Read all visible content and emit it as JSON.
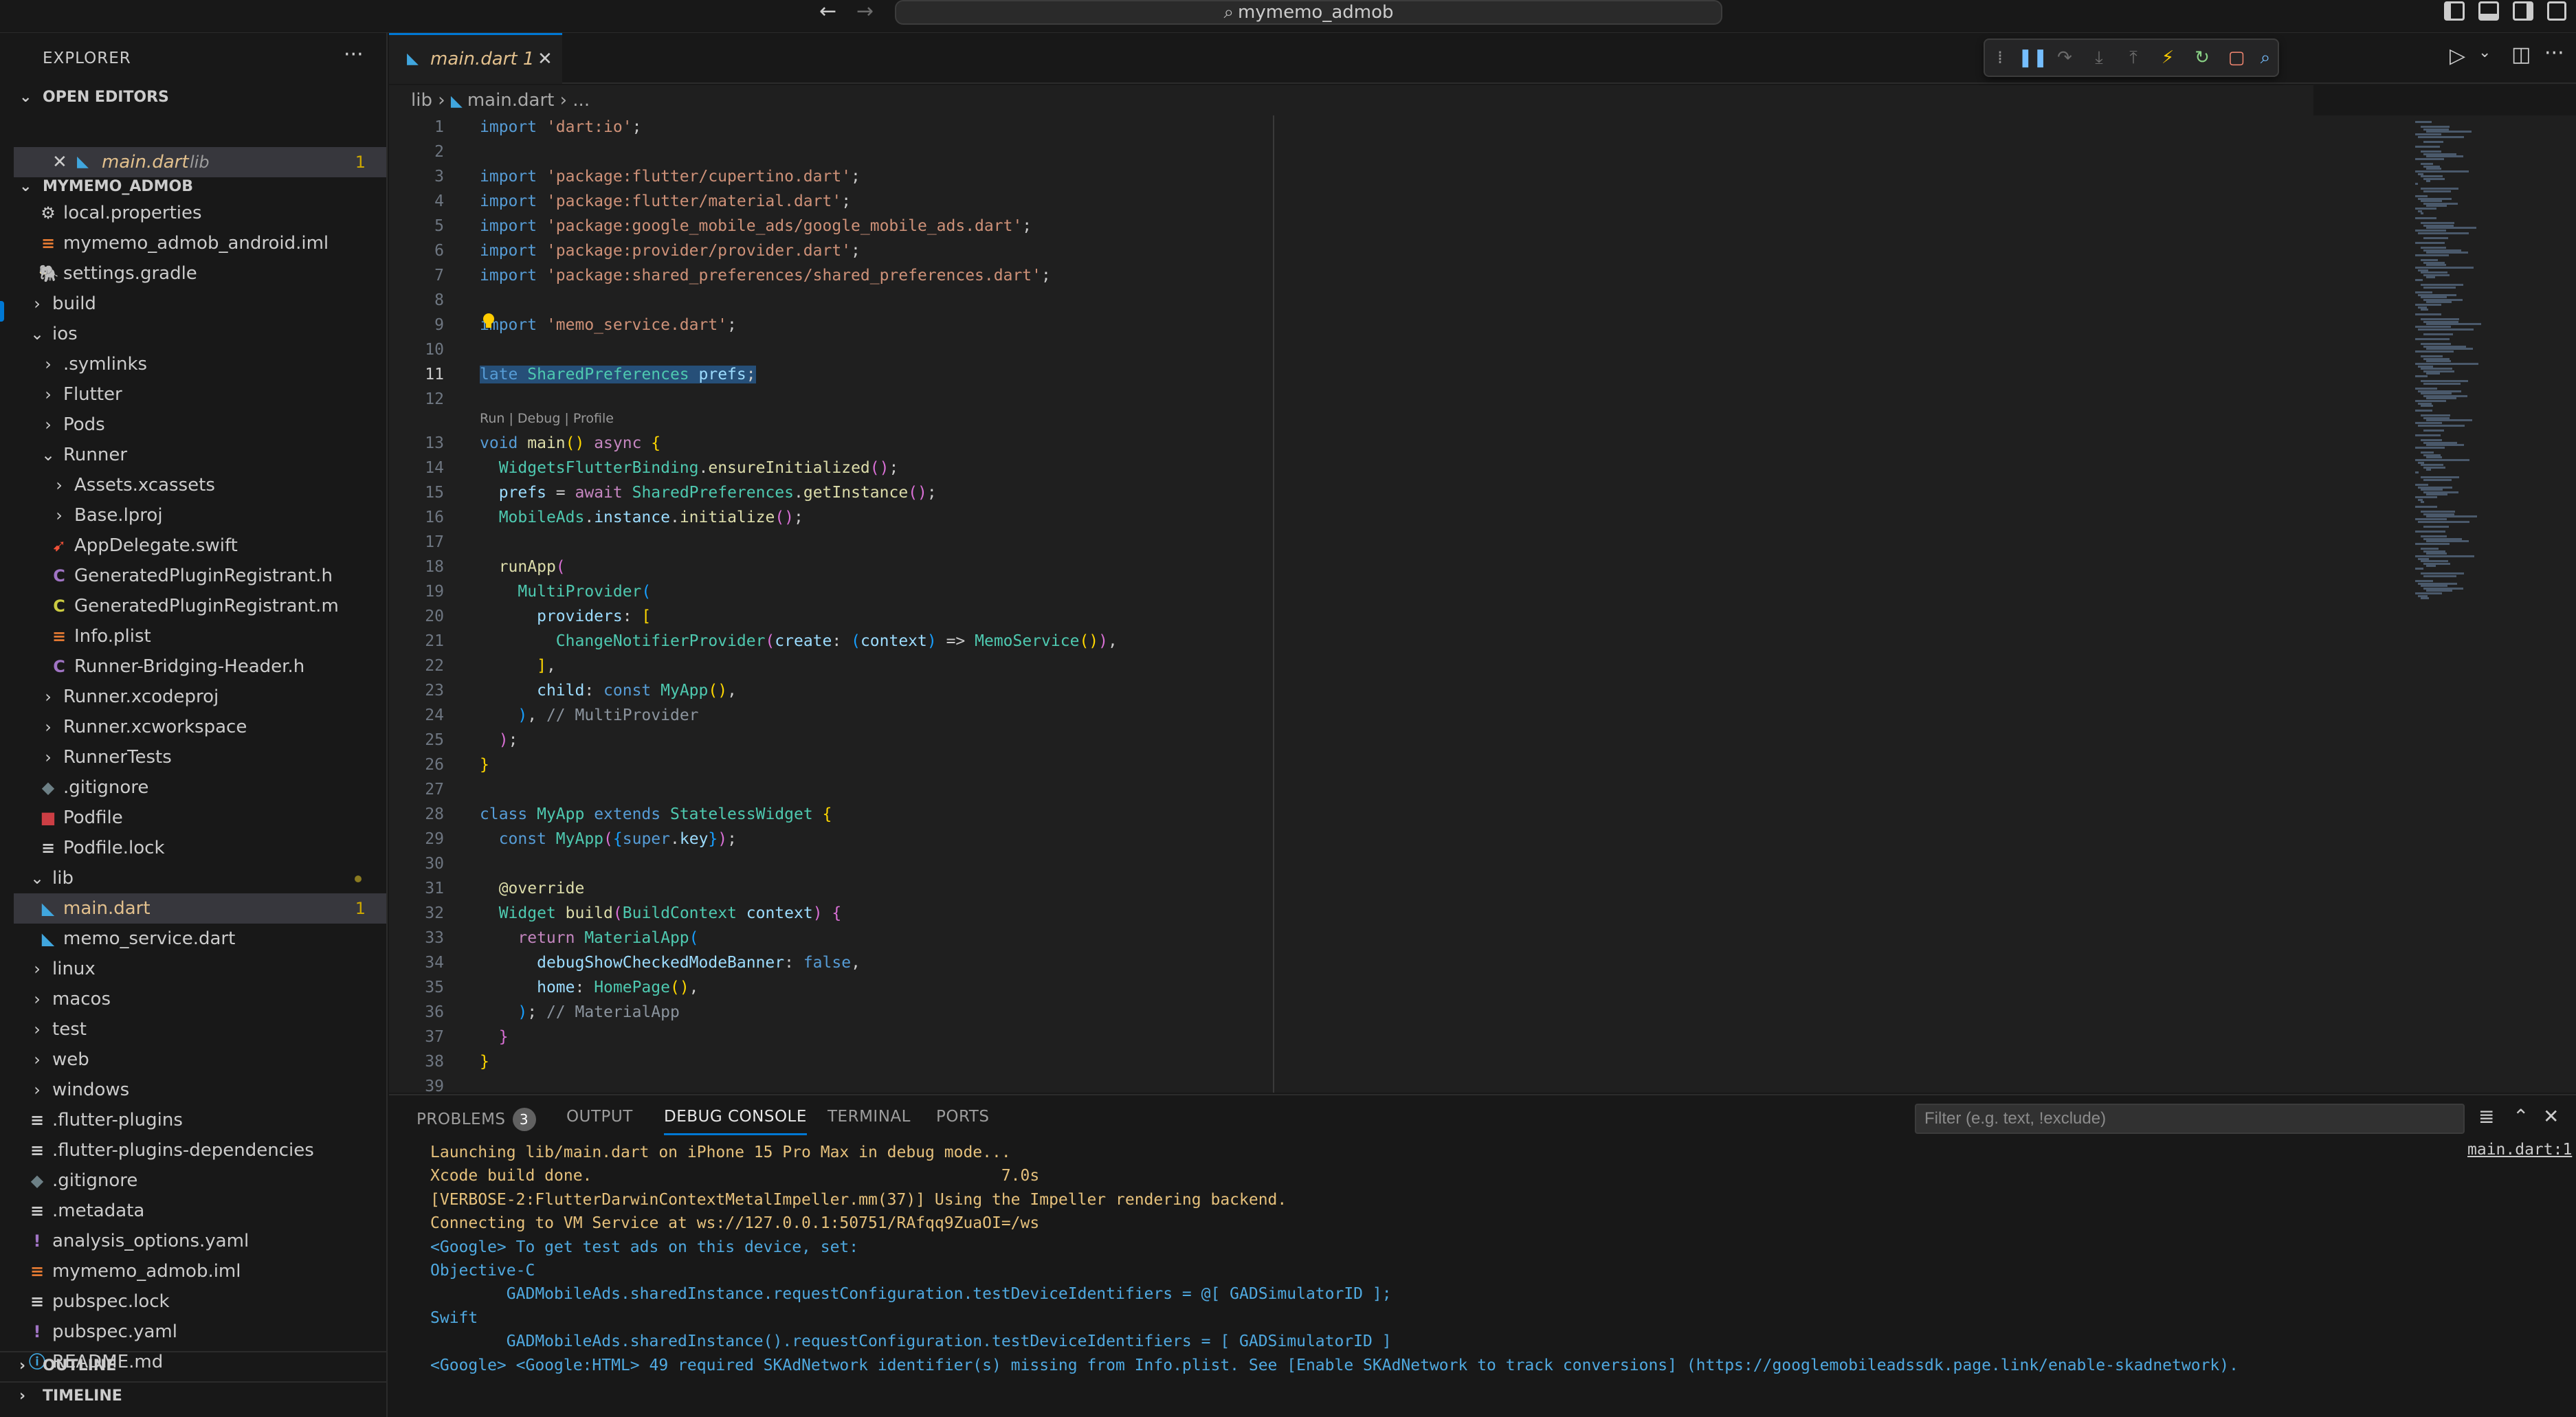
{
  "titlebar": {
    "search_text": "mymemo_admob",
    "back_icon": "arrow-left-icon",
    "forward_icon": "arrow-right-icon"
  },
  "sidebar": {
    "title": "EXPLORER",
    "more": "···",
    "open_editors": {
      "heading": "OPEN EDITORS",
      "file": "main.dart",
      "folder": "lib",
      "problems": "1"
    },
    "project": {
      "heading": "MYMEMO_ADMOB",
      "items": [
        {
          "label": "local.properties",
          "icon": "⚙",
          "color": "#cccccc",
          "indent": 1,
          "kind": "file"
        },
        {
          "label": "mymemo_admob_android.iml",
          "icon": "≡",
          "color": "#e37933",
          "indent": 1,
          "kind": "file"
        },
        {
          "label": "settings.gradle",
          "icon": "🐘",
          "color": "#5fa3cf",
          "indent": 1,
          "kind": "file"
        },
        {
          "label": "build",
          "indent": 0,
          "kind": "folder",
          "open": false
        },
        {
          "label": "ios",
          "indent": 0,
          "kind": "folder",
          "open": true
        },
        {
          "label": ".symlinks",
          "indent": 1,
          "kind": "folder",
          "open": false
        },
        {
          "label": "Flutter",
          "indent": 1,
          "kind": "folder",
          "open": false
        },
        {
          "label": "Pods",
          "indent": 1,
          "kind": "folder",
          "open": false
        },
        {
          "label": "Runner",
          "indent": 1,
          "kind": "folder",
          "open": true
        },
        {
          "label": "Assets.xcassets",
          "indent": 2,
          "kind": "folder",
          "open": false
        },
        {
          "label": "Base.lproj",
          "indent": 2,
          "kind": "folder",
          "open": false
        },
        {
          "label": "AppDelegate.swift",
          "icon": "➹",
          "color": "#f05138",
          "indent": 2,
          "kind": "file"
        },
        {
          "label": "GeneratedPluginRegistrant.h",
          "icon": "C",
          "color": "#a074c4",
          "indent": 2,
          "kind": "file"
        },
        {
          "label": "GeneratedPluginRegistrant.m",
          "icon": "C",
          "color": "#cbcb41",
          "indent": 2,
          "kind": "file"
        },
        {
          "label": "Info.plist",
          "icon": "≡",
          "color": "#e37933",
          "indent": 2,
          "kind": "file"
        },
        {
          "label": "Runner-Bridging-Header.h",
          "icon": "C",
          "color": "#a074c4",
          "indent": 2,
          "kind": "file"
        },
        {
          "label": "Runner.xcodeproj",
          "indent": 1,
          "kind": "folder",
          "open": false
        },
        {
          "label": "Runner.xcworkspace",
          "indent": 1,
          "kind": "folder",
          "open": false
        },
        {
          "label": "RunnerTests",
          "indent": 1,
          "kind": "folder",
          "open": false
        },
        {
          "label": ".gitignore",
          "icon": "◆",
          "color": "#6d8086",
          "indent": 1,
          "kind": "file"
        },
        {
          "label": "Podfile",
          "icon": "■",
          "color": "#cc3e44",
          "indent": 1,
          "kind": "file"
        },
        {
          "label": "Podfile.lock",
          "icon": "≡",
          "color": "#cccccc",
          "indent": 1,
          "kind": "file"
        },
        {
          "label": "lib",
          "indent": 0,
          "kind": "folder",
          "open": true,
          "dot": true
        },
        {
          "label": "main.dart",
          "icon": "◣",
          "color": "#40a6de",
          "indent": 1,
          "kind": "file",
          "selected": true,
          "badge": "1"
        },
        {
          "label": "memo_service.dart",
          "icon": "◣",
          "color": "#40a6de",
          "indent": 1,
          "kind": "file"
        },
        {
          "label": "linux",
          "indent": 0,
          "kind": "folder",
          "open": false
        },
        {
          "label": "macos",
          "indent": 0,
          "kind": "folder",
          "open": false
        },
        {
          "label": "test",
          "indent": 0,
          "kind": "folder",
          "open": false
        },
        {
          "label": "web",
          "indent": 0,
          "kind": "folder",
          "open": false
        },
        {
          "label": "windows",
          "indent": 0,
          "kind": "folder",
          "open": false
        },
        {
          "label": ".flutter-plugins",
          "icon": "≡",
          "color": "#cccccc",
          "indent": 0,
          "kind": "file"
        },
        {
          "label": ".flutter-plugins-dependencies",
          "icon": "≡",
          "color": "#cccccc",
          "indent": 0,
          "kind": "file"
        },
        {
          "label": ".gitignore",
          "icon": "◆",
          "color": "#6d8086",
          "indent": 0,
          "kind": "file"
        },
        {
          "label": ".metadata",
          "icon": "≡",
          "color": "#cccccc",
          "indent": 0,
          "kind": "file"
        },
        {
          "label": "analysis_options.yaml",
          "icon": "!",
          "color": "#a074c4",
          "indent": 0,
          "kind": "file"
        },
        {
          "label": "mymemo_admob.iml",
          "icon": "≡",
          "color": "#e37933",
          "indent": 0,
          "kind": "file"
        },
        {
          "label": "pubspec.lock",
          "icon": "≡",
          "color": "#cccccc",
          "indent": 0,
          "kind": "file"
        },
        {
          "label": "pubspec.yaml",
          "icon": "!",
          "color": "#a074c4",
          "indent": 0,
          "kind": "file"
        },
        {
          "label": "README.md",
          "icon": "ⓘ",
          "color": "#40a6de",
          "indent": 0,
          "kind": "file"
        }
      ]
    },
    "outline": "OUTLINE",
    "timeline": "TIMELINE"
  },
  "editor": {
    "tab_file": "main.dart",
    "tab_problems": "1",
    "breadcrumb": [
      "lib",
      "main.dart",
      "..."
    ],
    "codelens": "Run | Debug | Profile",
    "active_line": 11,
    "line_numbers": [
      "1",
      "2",
      "3",
      "4",
      "5",
      "6",
      "7",
      "8",
      "9",
      "10",
      "11",
      "12",
      "13",
      "14",
      "15",
      "16",
      "17",
      "18",
      "19",
      "20",
      "21",
      "22",
      "23",
      "24",
      "25",
      "26",
      "27",
      "28",
      "29",
      "30",
      "31",
      "32",
      "33",
      "34",
      "35",
      "36",
      "37",
      "38",
      "39"
    ],
    "lines": [
      [
        [
          "kw",
          "import "
        ],
        [
          "str",
          "'dart:io'"
        ],
        [
          "pl",
          ";"
        ]
      ],
      [],
      [
        [
          "kw",
          "import "
        ],
        [
          "str",
          "'package:flutter/cupertino.dart'"
        ],
        [
          "pl",
          ";"
        ]
      ],
      [
        [
          "kw",
          "import "
        ],
        [
          "str",
          "'package:flutter/material.dart'"
        ],
        [
          "pl",
          ";"
        ]
      ],
      [
        [
          "kw",
          "import "
        ],
        [
          "str",
          "'package:google_mobile_ads/google_mobile_ads.dart'"
        ],
        [
          "pl",
          ";"
        ]
      ],
      [
        [
          "kw",
          "import "
        ],
        [
          "str",
          "'package:provider/provider.dart'"
        ],
        [
          "pl",
          ";"
        ]
      ],
      [
        [
          "kw",
          "import "
        ],
        [
          "str",
          "'package:shared_preferences/shared_preferences.dart'"
        ],
        [
          "pl",
          ";"
        ]
      ],
      [],
      [
        [
          "kw",
          "import "
        ],
        [
          "str",
          "'memo_service.dart'"
        ],
        [
          "pl",
          ";"
        ]
      ],
      [],
      [
        [
          "kw sel",
          "late "
        ],
        [
          "cls sel",
          "SharedPreferences "
        ],
        [
          "var sel",
          "prefs"
        ],
        [
          "pl sel",
          ";"
        ]
      ],
      [],
      [
        [
          "kw",
          "void "
        ],
        [
          "fn",
          "main"
        ],
        [
          "br1",
          "()"
        ],
        [
          "pl",
          " "
        ],
        [
          "ctl",
          "async "
        ],
        [
          "br1",
          "{"
        ]
      ],
      [
        [
          "pl",
          "  "
        ],
        [
          "cls",
          "WidgetsFlutterBinding"
        ],
        [
          "pl",
          "."
        ],
        [
          "fn",
          "ensureInitialized"
        ],
        [
          "br2",
          "()"
        ],
        [
          "pl",
          ";"
        ]
      ],
      [
        [
          "pl",
          "  "
        ],
        [
          "var",
          "prefs"
        ],
        [
          "pl",
          " = "
        ],
        [
          "ctl",
          "await "
        ],
        [
          "cls",
          "SharedPreferences"
        ],
        [
          "pl",
          "."
        ],
        [
          "fn",
          "getInstance"
        ],
        [
          "br2",
          "()"
        ],
        [
          "pl",
          ";"
        ]
      ],
      [
        [
          "pl",
          "  "
        ],
        [
          "cls",
          "MobileAds"
        ],
        [
          "pl",
          "."
        ],
        [
          "var",
          "instance"
        ],
        [
          "pl",
          "."
        ],
        [
          "fn",
          "initialize"
        ],
        [
          "br2",
          "()"
        ],
        [
          "pl",
          ";"
        ]
      ],
      [],
      [
        [
          "pl",
          "  "
        ],
        [
          "fn",
          "runApp"
        ],
        [
          "br2",
          "("
        ]
      ],
      [
        [
          "pl",
          "    "
        ],
        [
          "cls",
          "MultiProvider"
        ],
        [
          "br3",
          "("
        ]
      ],
      [
        [
          "pl",
          "      "
        ],
        [
          "var",
          "providers"
        ],
        [
          "pl",
          ": "
        ],
        [
          "br1",
          "["
        ]
      ],
      [
        [
          "pl",
          "        "
        ],
        [
          "cls",
          "ChangeNotifierProvider"
        ],
        [
          "br2",
          "("
        ],
        [
          "var",
          "create"
        ],
        [
          "pl",
          ": "
        ],
        [
          "br3",
          "("
        ],
        [
          "var",
          "context"
        ],
        [
          "br3",
          ")"
        ],
        [
          "pl",
          " => "
        ],
        [
          "cls",
          "MemoService"
        ],
        [
          "br1",
          "()"
        ],
        [
          "br2",
          ")"
        ],
        [
          "pl",
          ","
        ]
      ],
      [
        [
          "pl",
          "      "
        ],
        [
          "br1",
          "]"
        ],
        [
          "pl",
          ","
        ]
      ],
      [
        [
          "pl",
          "      "
        ],
        [
          "var",
          "child"
        ],
        [
          "pl",
          ": "
        ],
        [
          "kw",
          "const "
        ],
        [
          "cls",
          "MyApp"
        ],
        [
          "br1",
          "()"
        ],
        [
          "pl",
          ","
        ]
      ],
      [
        [
          "pl",
          "    "
        ],
        [
          "br3",
          ")"
        ],
        [
          "pl",
          ", "
        ],
        [
          "cmg",
          "// MultiProvider"
        ]
      ],
      [
        [
          "pl",
          "  "
        ],
        [
          "br2",
          ")"
        ],
        [
          "pl",
          ";"
        ]
      ],
      [
        [
          "br1",
          "}"
        ]
      ],
      [],
      [
        [
          "kw",
          "class "
        ],
        [
          "cls",
          "MyApp "
        ],
        [
          "kw",
          "extends "
        ],
        [
          "cls",
          "StatelessWidget "
        ],
        [
          "br1",
          "{"
        ]
      ],
      [
        [
          "pl",
          "  "
        ],
        [
          "kw",
          "const "
        ],
        [
          "cls",
          "MyApp"
        ],
        [
          "br2",
          "("
        ],
        [
          "br3",
          "{"
        ],
        [
          "kw",
          "super"
        ],
        [
          "pl",
          "."
        ],
        [
          "var",
          "key"
        ],
        [
          "br3",
          "}"
        ],
        [
          "br2",
          ")"
        ],
        [
          "pl",
          ";"
        ]
      ],
      [],
      [
        [
          "pl",
          "  "
        ],
        [
          "fn",
          "@override"
        ]
      ],
      [
        [
          "pl",
          "  "
        ],
        [
          "cls",
          "Widget "
        ],
        [
          "fn",
          "build"
        ],
        [
          "br2",
          "("
        ],
        [
          "cls",
          "BuildContext "
        ],
        [
          "var",
          "context"
        ],
        [
          "br2",
          ")"
        ],
        [
          "pl",
          " "
        ],
        [
          "br2",
          "{"
        ]
      ],
      [
        [
          "pl",
          "    "
        ],
        [
          "ctl",
          "return "
        ],
        [
          "cls",
          "MaterialApp"
        ],
        [
          "br3",
          "("
        ]
      ],
      [
        [
          "pl",
          "      "
        ],
        [
          "var",
          "debugShowCheckedModeBanner"
        ],
        [
          "pl",
          ": "
        ],
        [
          "kw",
          "false"
        ],
        [
          "pl",
          ","
        ]
      ],
      [
        [
          "pl",
          "      "
        ],
        [
          "var",
          "home"
        ],
        [
          "pl",
          ": "
        ],
        [
          "cls",
          "HomePage"
        ],
        [
          "br1",
          "()"
        ],
        [
          "pl",
          ","
        ]
      ],
      [
        [
          "pl",
          "    "
        ],
        [
          "br3",
          ")"
        ],
        [
          "pl",
          "; "
        ],
        [
          "cmg",
          "// MaterialApp"
        ]
      ],
      [
        [
          "pl",
          "  "
        ],
        [
          "br2",
          "}"
        ]
      ],
      [
        [
          "br1",
          "}"
        ]
      ],
      []
    ]
  },
  "panel": {
    "tabs": [
      {
        "label": "PROBLEMS",
        "count": "3"
      },
      {
        "label": "OUTPUT"
      },
      {
        "label": "DEBUG CONSOLE",
        "active": true
      },
      {
        "label": "TERMINAL"
      },
      {
        "label": "PORTS"
      }
    ],
    "filter_placeholder": "Filter (e.g. text, !exclude)",
    "source_link": "main.dart:1",
    "console": [
      {
        "text": "Launching lib/main.dart on iPhone 15 Pro Max in debug mode...",
        "color": "orange"
      },
      {
        "text": "Xcode build done.                                           7.0s",
        "color": "orange"
      },
      {
        "text": "[VERBOSE-2:FlutterDarwinContextMetalImpeller.mm(37)] Using the Impeller rendering backend.",
        "color": "orange"
      },
      {
        "text": "Connecting to VM Service at ws://127.0.0.1:50751/RAfqq9ZuaOI=/ws",
        "color": "orange"
      },
      {
        "text": "<Google> To get test ads on this device, set:",
        "color": "blue"
      },
      {
        "text": "Objective-C",
        "color": "blue"
      },
      {
        "text": "        GADMobileAds.sharedInstance.requestConfiguration.testDeviceIdentifiers = @[ GADSimulatorID ];",
        "color": "blue"
      },
      {
        "text": "Swift",
        "color": "blue"
      },
      {
        "text": "        GADMobileAds.sharedInstance().requestConfiguration.testDeviceIdentifiers = [ GADSimulatorID ]",
        "color": "blue"
      },
      {
        "text": "<Google> <Google:HTML> 49 required SKAdNetwork identifier(s) missing from Info.plist. See [Enable SKAdNetwork to track conversions] (https://googlemobileadssdk.page.link/enable-skadnetwork).",
        "color": "blue"
      }
    ]
  },
  "icons": {
    "debug_toolbar": [
      "drag-handle-icon",
      "pause-icon",
      "step-over-icon",
      "step-into-icon",
      "step-out-icon",
      "hot-reload-icon",
      "restart-icon",
      "stop-icon",
      "inspect-widget-icon"
    ]
  }
}
